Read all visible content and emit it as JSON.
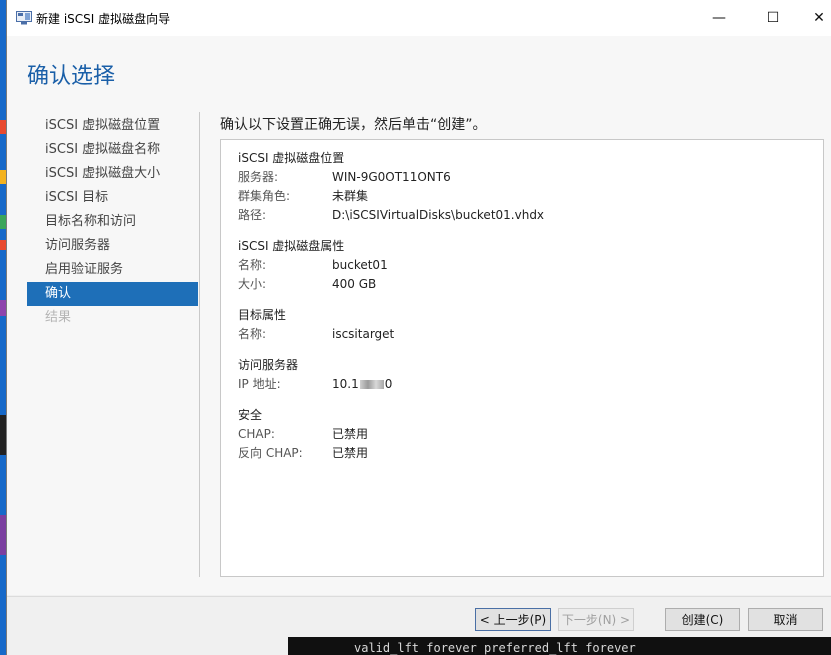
{
  "window": {
    "title": "新建 iSCSI 虚拟磁盘向导",
    "minimize_glyph": "—",
    "maximize_glyph": "☐",
    "close_glyph": "✕"
  },
  "page": {
    "title": "确认选择",
    "instruction": "确认以下设置正确无误，然后单击“创建”。"
  },
  "nav": {
    "items": [
      {
        "label": "iSCSI 虚拟磁盘位置",
        "state": "normal"
      },
      {
        "label": "iSCSI 虚拟磁盘名称",
        "state": "normal"
      },
      {
        "label": "iSCSI 虚拟磁盘大小",
        "state": "normal"
      },
      {
        "label": "iSCSI 目标",
        "state": "normal"
      },
      {
        "label": "目标名称和访问",
        "state": "normal"
      },
      {
        "label": "访问服务器",
        "state": "normal"
      },
      {
        "label": "启用验证服务",
        "state": "normal"
      },
      {
        "label": "确认",
        "state": "active"
      },
      {
        "label": "结果",
        "state": "disabled"
      }
    ]
  },
  "summary": {
    "location": {
      "title": "iSCSI 虚拟磁盘位置",
      "rows": [
        {
          "key": "服务器:",
          "value": "WIN-9G0OT11ONT6"
        },
        {
          "key": "群集角色:",
          "value": "未群集"
        },
        {
          "key": "路径:",
          "value": "D:\\iSCSIVirtualDisks\\bucket01.vhdx"
        }
      ]
    },
    "properties": {
      "title": "iSCSI 虚拟磁盘属性",
      "rows": [
        {
          "key": "名称:",
          "value": "bucket01"
        },
        {
          "key": "大小:",
          "value": "400 GB"
        }
      ]
    },
    "target": {
      "title": "目标属性",
      "rows": [
        {
          "key": "名称:",
          "value": "iscsitarget"
        }
      ]
    },
    "access": {
      "title": "访问服务器",
      "ip_key": "IP 地址:",
      "ip_prefix": "10.1",
      "ip_suffix": "0"
    },
    "security": {
      "title": "安全",
      "rows": [
        {
          "key": "CHAP:",
          "value": "已禁用"
        },
        {
          "key": "反向 CHAP:",
          "value": "已禁用"
        }
      ]
    }
  },
  "buttons": {
    "prev": "< 上一步(P)",
    "next": "下一步(N) >",
    "create": "创建(C)",
    "cancel": "取消"
  },
  "terminal": {
    "text": "valid_lft forever preferred_lft forever"
  },
  "colors": {
    "accent": "#1e6fb8",
    "title_blue": "#1a5fa8"
  }
}
